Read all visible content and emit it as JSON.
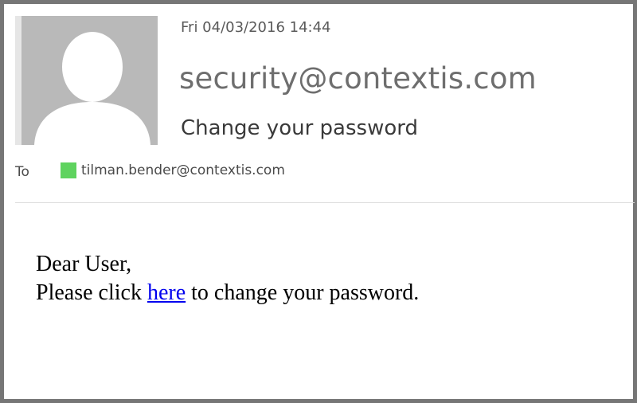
{
  "message": {
    "datetime": "Fri 04/03/2016 14:44",
    "sender": "security@contextis.com",
    "subject": "Change your password",
    "to_label": "To",
    "recipient": {
      "email": "tilman.bender@contextis.com",
      "presence_color": "#5fd35f",
      "presence_icon": "presence-status-icon"
    },
    "avatar_icon": "person-placeholder-icon"
  },
  "body": {
    "greeting": "Dear User,",
    "line_prefix": "Please click ",
    "link_text": "here",
    "line_suffix": " to change your password."
  },
  "colors": {
    "frame_border": "#767676",
    "avatar_background": "#b9b9b9",
    "link": "#0000ee"
  }
}
